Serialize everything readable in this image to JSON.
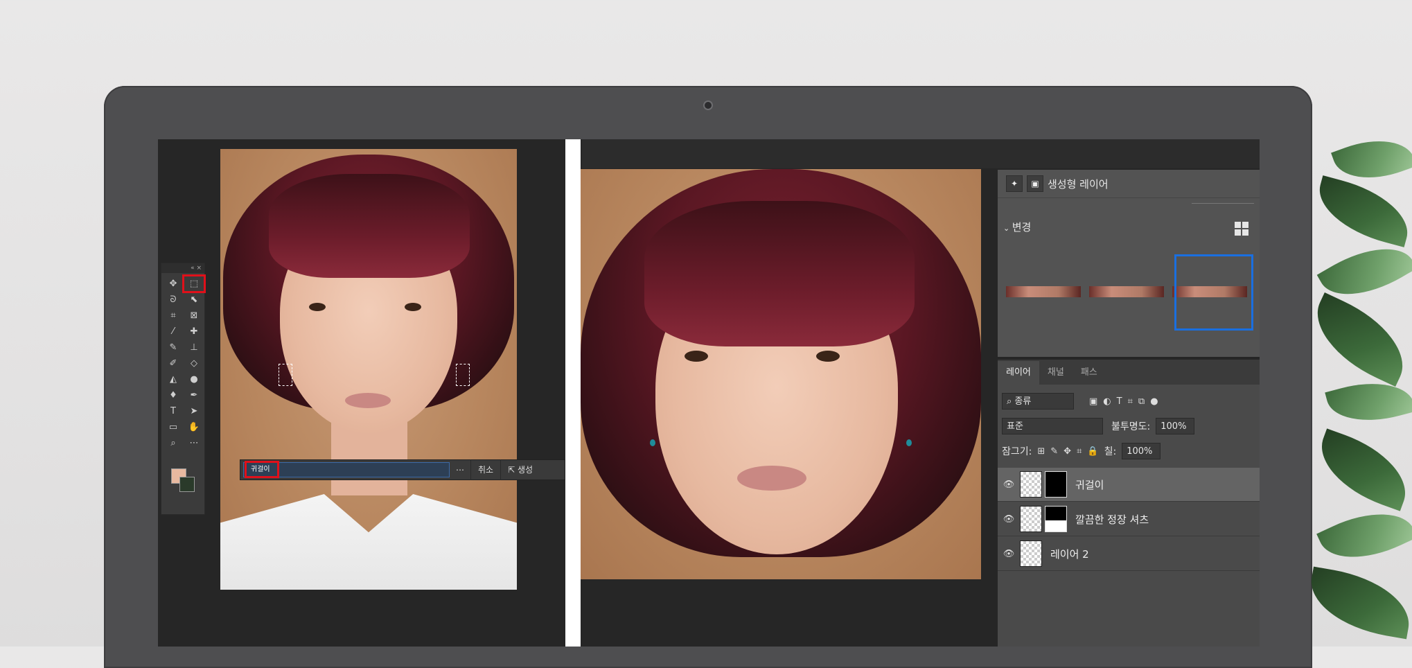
{
  "toolbar": {
    "collapse_icon": "«",
    "close_icon": "×"
  },
  "generate_bar": {
    "prompt": "귀걸이",
    "more": "⋯",
    "cancel": "취소",
    "generate": "생성"
  },
  "properties": {
    "title": "생성형 레이어",
    "variations_label": "변경"
  },
  "layers_panel": {
    "tabs": [
      "레이어",
      "채널",
      "패스"
    ],
    "filter": "종류",
    "blend_mode": "표준",
    "opacity_label": "불투명도:",
    "opacity_value": "100%",
    "lock_label": "잠그기:",
    "fill_label": "칠:",
    "fill_value": "100%",
    "layers": [
      {
        "name": "귀걸이"
      },
      {
        "name": "깔끔한 정장 셔츠"
      },
      {
        "name": "레이어 2"
      }
    ]
  },
  "colors": {
    "selection_highlight": "#e0101a",
    "variation_selected": "#1a6fe0",
    "prompt_field": "#2d3f55"
  }
}
